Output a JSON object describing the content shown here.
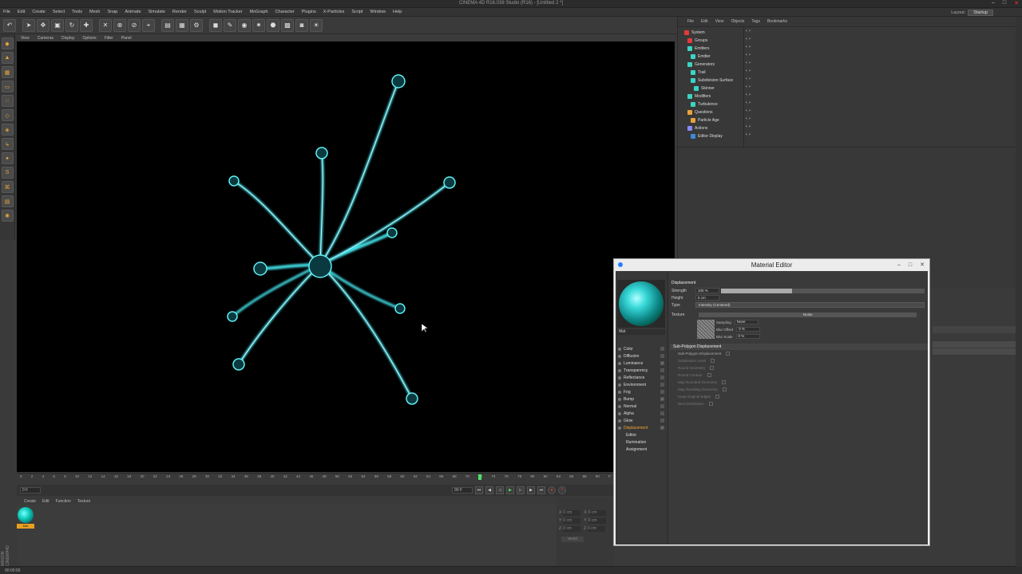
{
  "window": {
    "title": "CINEMA 4D R16.038 Studio (R16) - [Untitled 2 *]"
  },
  "menu": [
    "File",
    "Edit",
    "Create",
    "Select",
    "Tools",
    "Mesh",
    "Snap",
    "Animate",
    "Simulate",
    "Render",
    "Sculpt",
    "Motion Tracker",
    "MoGraph",
    "Character",
    "Plugins",
    "X-Particles",
    "Script",
    "Window",
    "Help"
  ],
  "layout": {
    "label": "Layout:",
    "value": "Startup"
  },
  "viewport_menu": [
    "View",
    "Cameras",
    "Display",
    "Options",
    "Filter",
    "Panel"
  ],
  "timeline": {
    "ticks": [
      "0",
      "2",
      "4",
      "6",
      "8",
      "10",
      "12",
      "14",
      "16",
      "18",
      "20",
      "22",
      "24",
      "26",
      "28",
      "30",
      "32",
      "34",
      "36",
      "38",
      "40",
      "42",
      "44",
      "46",
      "48",
      "50",
      "52",
      "54",
      "56",
      "58",
      "60",
      "62",
      "64",
      "66",
      "68",
      "70",
      "72",
      "74",
      "76",
      "78",
      "80",
      "82",
      "84",
      "86",
      "88",
      "90",
      "F"
    ],
    "start_field": "0 F",
    "end_field": "90 F",
    "playhead_frame": 66
  },
  "material_manager": {
    "menu": [
      "Create",
      "Edit",
      "Function",
      "Texture"
    ],
    "material_label": "Mat"
  },
  "coordinates": {
    "rows": [
      {
        "axis": "X",
        "v1": "0 cm",
        "axis2": "X",
        "v2": "0 cm"
      },
      {
        "axis": "Y",
        "v1": "0 cm",
        "axis2": "Y",
        "v2": "0 cm"
      },
      {
        "axis": "Z",
        "v1": "0 cm",
        "axis2": "Z",
        "v2": "0 cm"
      }
    ],
    "apply_label": "World"
  },
  "status": {
    "time": "00:00:00"
  },
  "object_manager": {
    "menu": [
      "File",
      "Edit",
      "View",
      "Objects",
      "Tags",
      "Bookmarks"
    ],
    "items": [
      {
        "label": "System",
        "color": "#e33b3b"
      },
      {
        "label": "Groups",
        "color": "#e33b3b"
      },
      {
        "label": "Emitters",
        "color": "#3bd4c4"
      },
      {
        "label": "Emitter",
        "color": "#3bd4c4"
      },
      {
        "label": "Generators",
        "color": "#3bd4c4"
      },
      {
        "label": "Trail",
        "color": "#3bd4c4"
      },
      {
        "label": "Subdivision Surface",
        "color": "#3bd4c4"
      },
      {
        "label": "Skinner",
        "color": "#3bd4c4"
      },
      {
        "label": "Modifiers",
        "color": "#3bd4c4"
      },
      {
        "label": "Turbulence",
        "color": "#3bd4c4"
      },
      {
        "label": "Questions",
        "color": "#e9a23a"
      },
      {
        "label": "Particle Age",
        "color": "#e9a23a"
      },
      {
        "label": "Actions",
        "color": "#8888ff"
      },
      {
        "label": "Editor Display",
        "color": "#3b8bd4"
      }
    ]
  },
  "material_editor": {
    "title": "Material Editor",
    "name": "Mat",
    "channels": [
      {
        "label": "Color",
        "checked": false
      },
      {
        "label": "Diffusion",
        "checked": false
      },
      {
        "label": "Luminance",
        "checked": true
      },
      {
        "label": "Transparency",
        "checked": false
      },
      {
        "label": "Reflectance",
        "checked": false
      },
      {
        "label": "Environment",
        "checked": false
      },
      {
        "label": "Fog",
        "checked": false
      },
      {
        "label": "Bump",
        "checked": true
      },
      {
        "label": "Normal",
        "checked": false
      },
      {
        "label": "Alpha",
        "checked": false
      },
      {
        "label": "Glow",
        "checked": false
      },
      {
        "label": "Displacement",
        "checked": true,
        "active": true
      }
    ],
    "sub_channels": [
      "Editor",
      "Illumination",
      "Assignment"
    ],
    "section": "Displacement",
    "strength": {
      "label": "Strength",
      "value": "100 %",
      "fill": 0.35
    },
    "height": {
      "label": "Height",
      "value": "5 cm"
    },
    "type": {
      "label": "Type",
      "value": "Intensity (Centered)"
    },
    "texture": {
      "label": "Texture",
      "shader": "Noise"
    },
    "sampling": {
      "label": "Sampling",
      "value": "None"
    },
    "blur_offset": {
      "label": "Blur Offset",
      "value": "0 %"
    },
    "blur_scale": {
      "label": "Blur Scale",
      "value": "0 %"
    },
    "spd_section": "Sub-Polygon Displacement",
    "spd_enable": "Sub-Polygon Displacement",
    "spd_options": [
      "Subdivision Level",
      "Round Geometry",
      "Round Contour",
      "Map Rounded Geometry",
      "Map Resulting Geometry",
      "Keep Original Edges",
      "Best Distribution"
    ]
  }
}
